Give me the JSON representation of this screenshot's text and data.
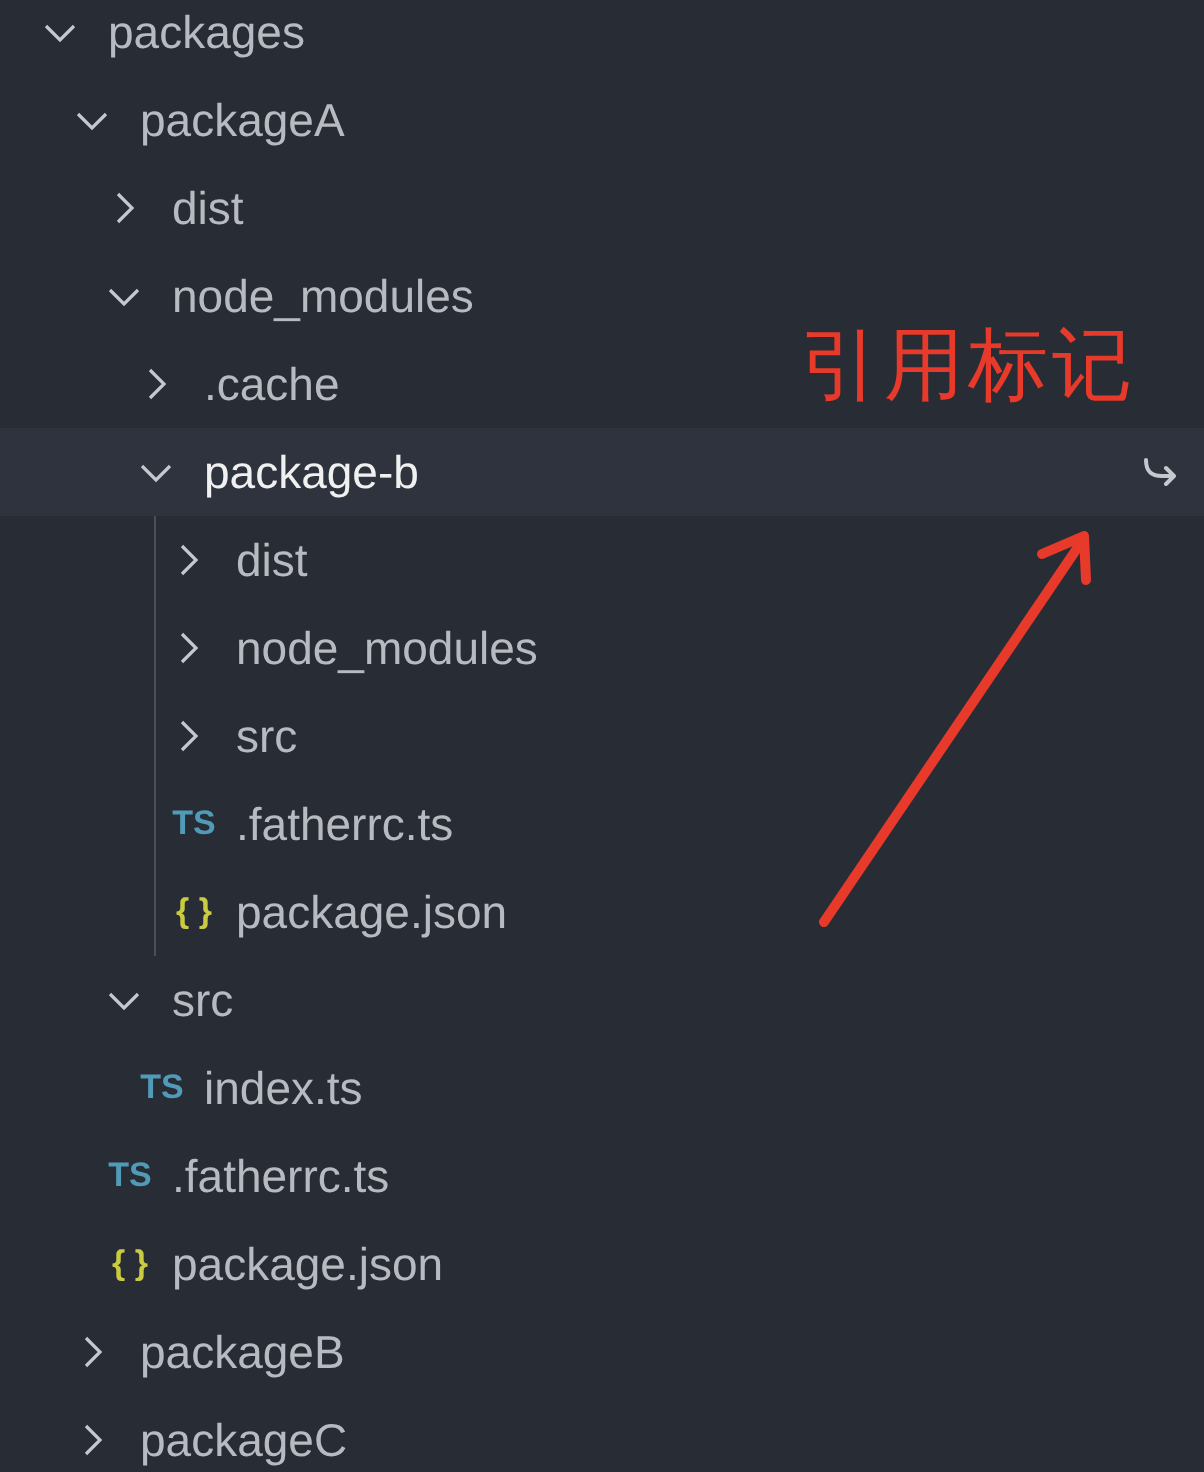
{
  "explorer": {
    "tree": [
      {
        "kind": "folder",
        "name": "packages",
        "expanded": true,
        "selected": false,
        "children": [
          {
            "kind": "folder",
            "name": "packageA",
            "expanded": true,
            "selected": false,
            "children": [
              {
                "kind": "folder",
                "name": "dist",
                "expanded": false,
                "selected": false
              },
              {
                "kind": "folder",
                "name": "node_modules",
                "expanded": true,
                "selected": false,
                "children": [
                  {
                    "kind": "folder",
                    "name": ".cache",
                    "expanded": false,
                    "selected": false
                  },
                  {
                    "kind": "folder",
                    "name": "package-b",
                    "expanded": true,
                    "selected": true,
                    "symlink": true,
                    "children": [
                      {
                        "kind": "folder",
                        "name": "dist",
                        "expanded": false,
                        "selected": false
                      },
                      {
                        "kind": "folder",
                        "name": "node_modules",
                        "expanded": false,
                        "selected": false
                      },
                      {
                        "kind": "folder",
                        "name": "src",
                        "expanded": false,
                        "selected": false
                      },
                      {
                        "kind": "ts",
                        "badge": "TS",
                        "name": ".fatherrc.ts",
                        "selected": false
                      },
                      {
                        "kind": "json",
                        "badge": "{ }",
                        "name": "package.json",
                        "selected": false
                      }
                    ]
                  }
                ]
              },
              {
                "kind": "folder",
                "name": "src",
                "expanded": true,
                "selected": false,
                "children": [
                  {
                    "kind": "ts",
                    "badge": "TS",
                    "name": "index.ts",
                    "selected": false
                  }
                ]
              },
              {
                "kind": "ts",
                "badge": "TS",
                "name": ".fatherrc.ts",
                "selected": false
              },
              {
                "kind": "json",
                "badge": "{ }",
                "name": "package.json",
                "selected": false
              }
            ]
          },
          {
            "kind": "folder",
            "name": "packageB",
            "expanded": false,
            "selected": false
          },
          {
            "kind": "folder",
            "name": "packageC",
            "expanded": false,
            "selected": false
          }
        ]
      }
    ]
  },
  "annotation": {
    "label": "引用标记"
  }
}
